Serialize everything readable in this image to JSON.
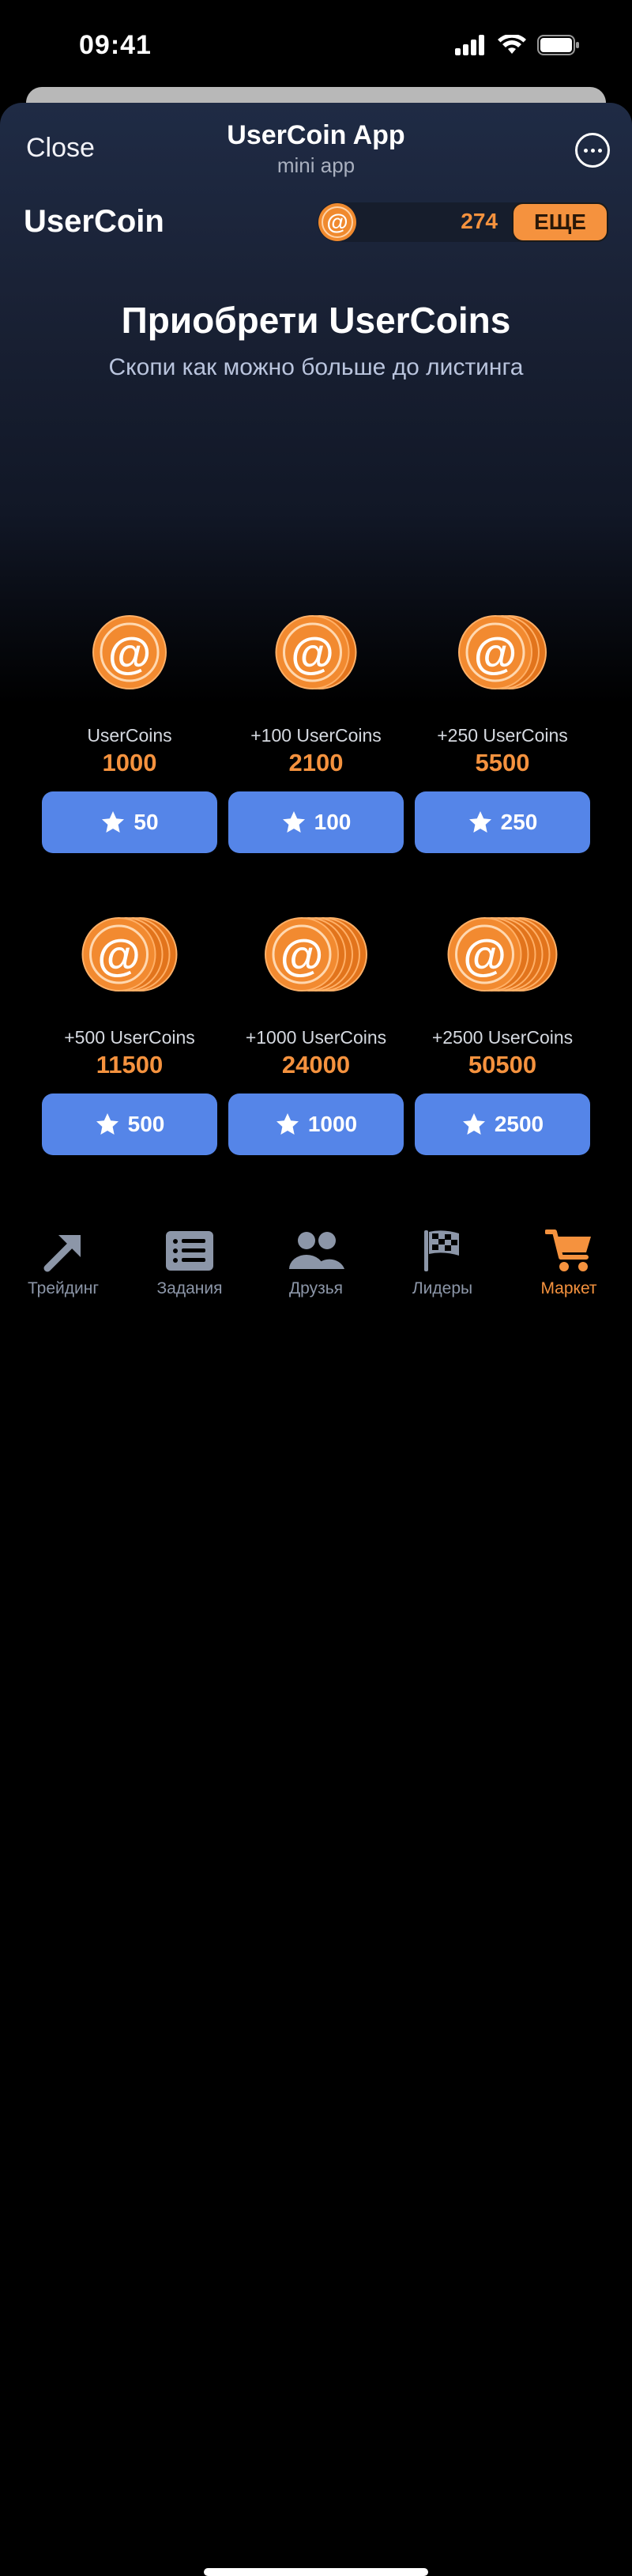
{
  "status_bar": {
    "time": "09:41"
  },
  "header": {
    "close_label": "Close",
    "title": "UserCoin App",
    "subtitle": "mini app"
  },
  "topbar": {
    "brand": "UserCoin",
    "balance": "274",
    "more_button": "ЕЩЕ"
  },
  "hero": {
    "title": "Приобрети UserCoins",
    "subtitle": "Скопи как можно больше до листинга"
  },
  "packs": [
    {
      "label": "UserCoins",
      "amount": "1000",
      "price": "50",
      "coin_stack": 1
    },
    {
      "label": "+100 UserCoins",
      "amount": "2100",
      "price": "100",
      "coin_stack": 2
    },
    {
      "label": "+250 UserCoins",
      "amount": "5500",
      "price": "250",
      "coin_stack": 3
    },
    {
      "label": "+500 UserCoins",
      "amount": "11500",
      "price": "500",
      "coin_stack": 4
    },
    {
      "label": "+1000 UserCoins",
      "amount": "24000",
      "price": "1000",
      "coin_stack": 5
    },
    {
      "label": "+2500 UserCoins",
      "amount": "50500",
      "price": "2500",
      "coin_stack": 6
    }
  ],
  "tabs": [
    {
      "label": "Трейдинг",
      "icon": "trend-arrow-icon",
      "active": false
    },
    {
      "label": "Задания",
      "icon": "task-list-icon",
      "active": false
    },
    {
      "label": "Друзья",
      "icon": "friends-icon",
      "active": false
    },
    {
      "label": "Лидеры",
      "icon": "checkered-flag-icon",
      "active": false
    },
    {
      "label": "Маркет",
      "icon": "cart-icon",
      "active": true
    }
  ],
  "colors": {
    "accent_orange": "#f5923e",
    "button_blue": "#5585e8",
    "tab_inactive": "#8c96a8"
  }
}
